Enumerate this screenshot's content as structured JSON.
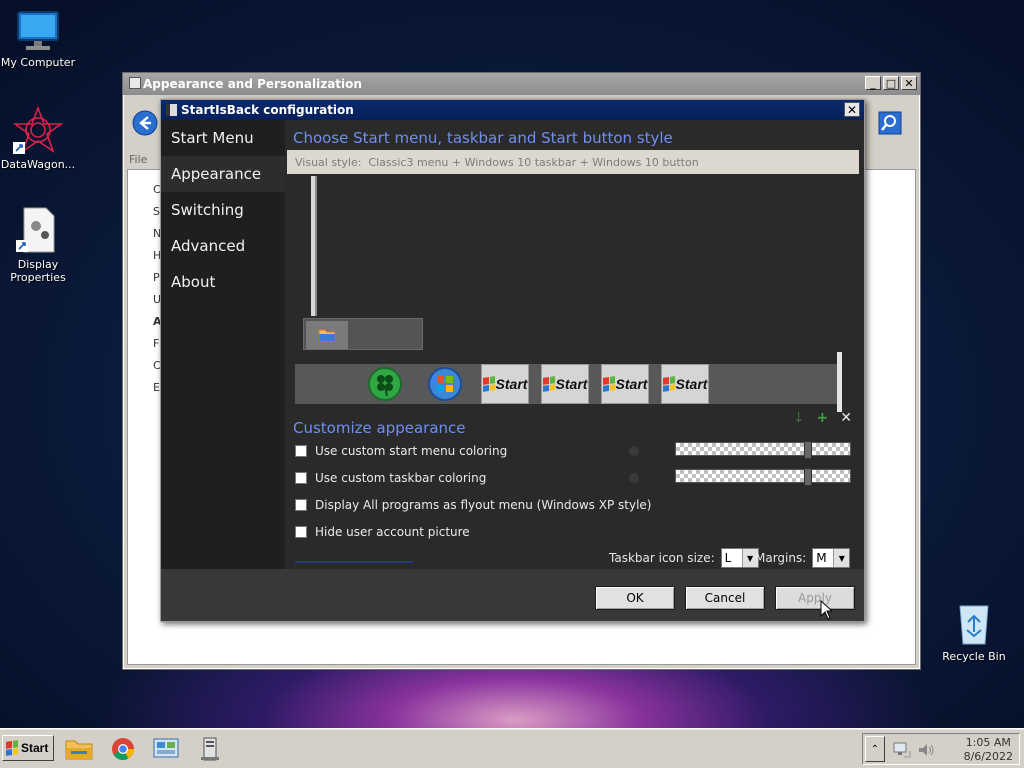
{
  "desktop": {
    "icons": [
      {
        "label": "My Computer"
      },
      {
        "label": "DataWagon..."
      },
      {
        "label": "Display Properties"
      },
      {
        "label": "Recycle Bin"
      }
    ]
  },
  "back_window": {
    "title": "Appearance and Personalization",
    "menu_label": "File",
    "side_letters": [
      "C",
      "S",
      "N",
      "H",
      "P",
      "U",
      "A",
      "F",
      "C",
      "E"
    ]
  },
  "dialog": {
    "title": "StartIsBack configuration",
    "nav": [
      "Start Menu",
      "Appearance",
      "Switching",
      "Advanced",
      "About"
    ],
    "active_nav": "Appearance",
    "heading_style": "Choose Start menu, taskbar and Start button style",
    "visual_style_label": "Visual style:",
    "visual_style_value": "Classic3 menu + Windows 10 taskbar + Windows 10 button",
    "start_buttons": [
      "clover",
      "windows-orb",
      "Start",
      "Start",
      "Start",
      "Start"
    ],
    "start_text": "Start",
    "heading_customize": "Customize appearance",
    "options": [
      {
        "label": "Use custom start menu coloring",
        "checked": false
      },
      {
        "label": "Use custom taskbar coloring",
        "checked": false
      },
      {
        "label": "Display All programs as flyout menu (Windows XP style)",
        "checked": false
      },
      {
        "label": "Hide user account picture",
        "checked": false
      }
    ],
    "taskbar_icon_size_label": "Taskbar icon size:",
    "taskbar_icon_size_value": "L",
    "margins_label": "Margins:",
    "margins_value": "M",
    "buttons": {
      "ok": "OK",
      "cancel": "Cancel",
      "apply": "Apply"
    }
  },
  "taskbar": {
    "start_label": "Start",
    "clock_time": "1:05 AM",
    "clock_date": "8/6/2022"
  },
  "colors": {
    "dialog_bg": "#1f1f1f",
    "heading_blue": "#6f8ff0",
    "titlebar_blue": "#0b2a6e"
  }
}
